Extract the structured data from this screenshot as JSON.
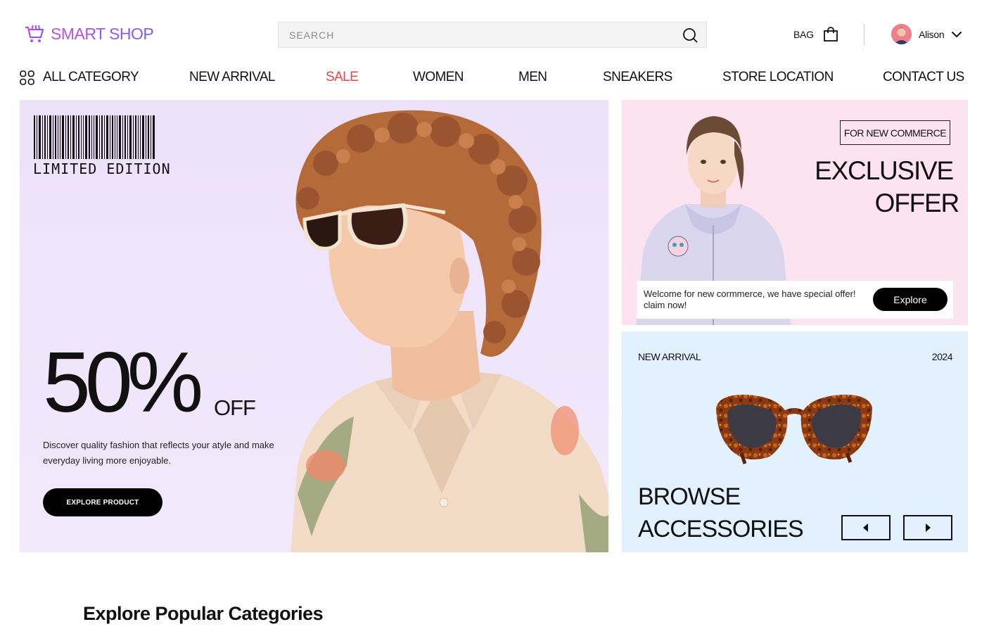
{
  "header": {
    "logo_text": "SMART SHOP",
    "search_placeholder": "SEARCH",
    "bag_label": "BAG",
    "user_name": "Alison"
  },
  "nav": {
    "all_category": "ALL CATEGORY",
    "items": [
      "NEW ARRIVAL",
      "SALE",
      "WOMEN",
      "MEN",
      "SNEAKERS",
      "STORE LOCATION",
      "CONTACT US"
    ],
    "active_color": "#e8464c"
  },
  "hero": {
    "badge": "LIMITED EDITION",
    "discount": "50%",
    "discount_suffix": "OFF",
    "description": "Discover quality fashion that reflects your atyle and make everyday living more enjoyable.",
    "button_label": "EXPLORE PRODUCT",
    "background": "#eee1fa"
  },
  "offer_card": {
    "tag": "FOR NEW COMMERCE",
    "title_line1": "EXCLUSIVE",
    "title_line2": "OFFER",
    "welcome_text": "Welcome for new cormmerce, we have special offer! claim now!",
    "button_label": "Explore",
    "background": "#fde3ef"
  },
  "accessories_card": {
    "label": "NEW ARRIVAL",
    "year": "2024",
    "title_line1": "BROWSE",
    "title_line2": "ACCESSORIES",
    "background": "#e3f1fe"
  },
  "section": {
    "title": "Explore Popular Categories"
  },
  "icons": [
    "cart-logo-icon",
    "search-icon",
    "shopping-bag-icon",
    "chevron-down-icon",
    "grid-icon",
    "arrow-left-icon",
    "arrow-right-icon"
  ]
}
